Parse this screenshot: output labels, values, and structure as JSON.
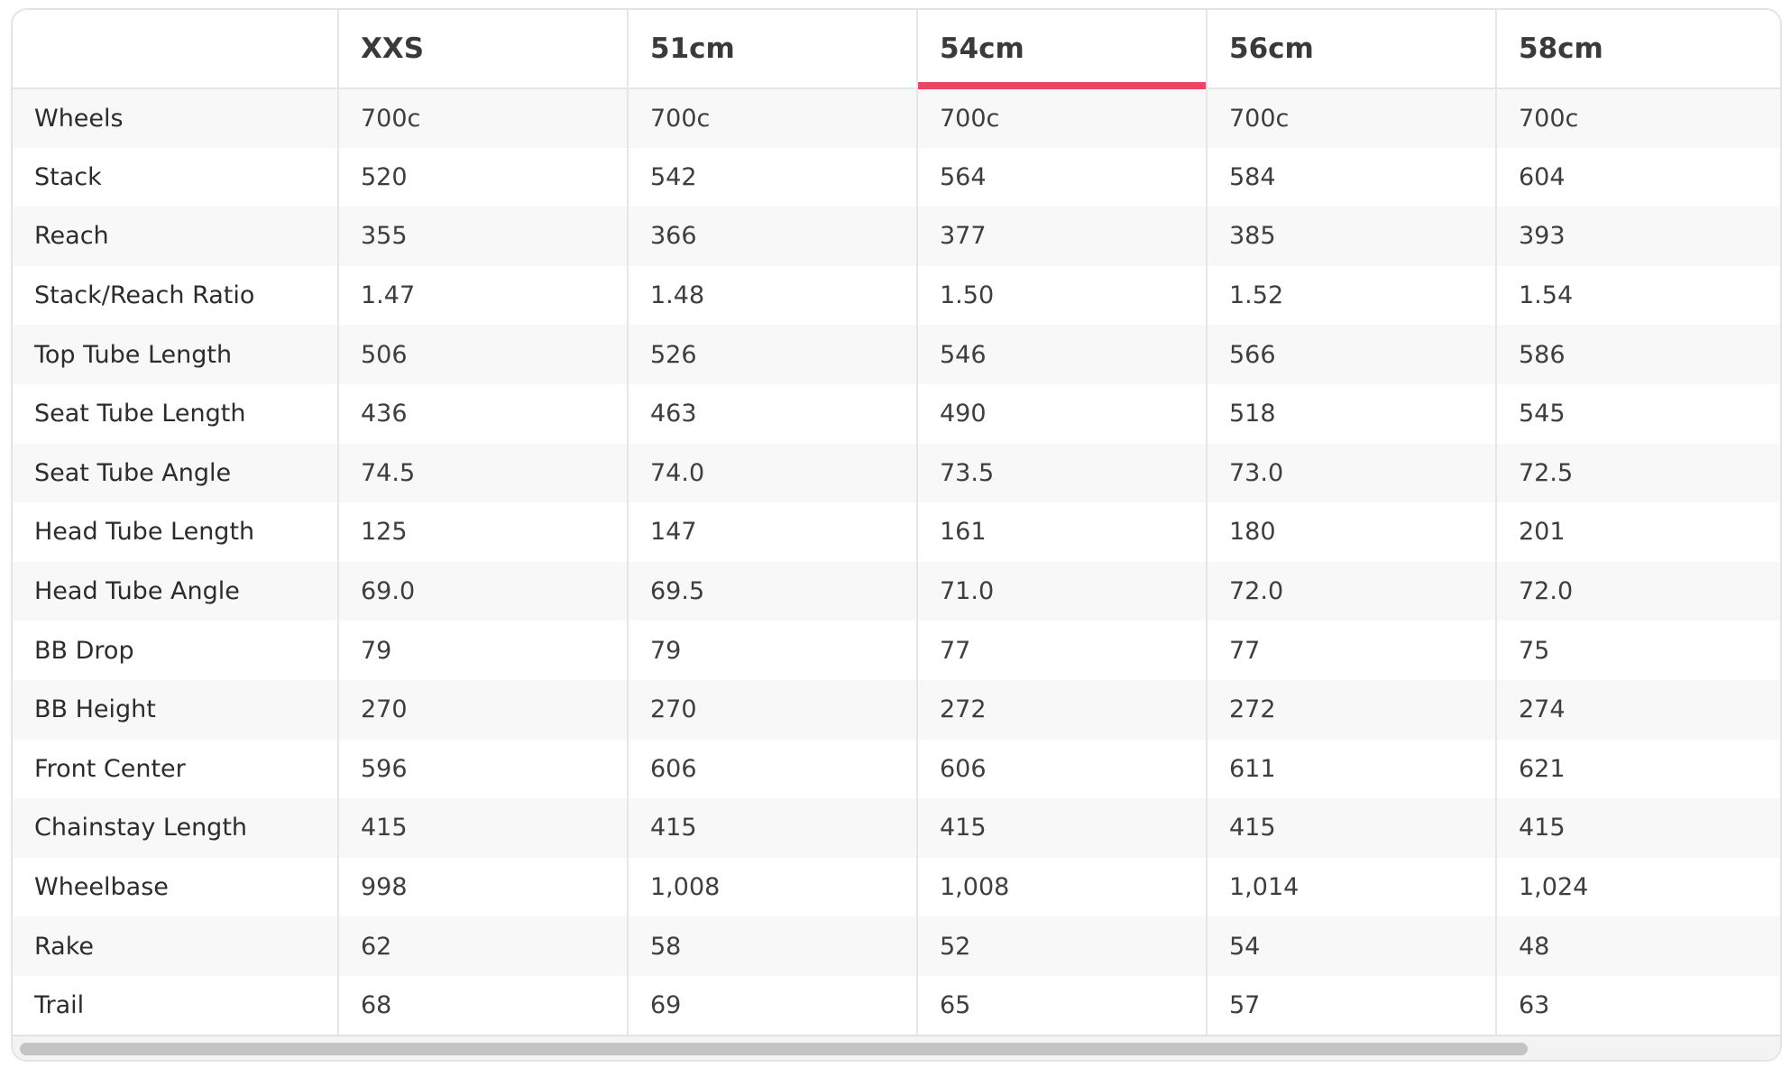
{
  "table": {
    "corner_label": "",
    "selected_column_index": 2,
    "accent_color": "#ea4564",
    "columns": [
      "XXS",
      "51cm",
      "54cm",
      "56cm",
      "58cm"
    ],
    "rows": [
      {
        "label": "Wheels",
        "values": [
          "700c",
          "700c",
          "700c",
          "700c",
          "700c"
        ]
      },
      {
        "label": "Stack",
        "values": [
          "520",
          "542",
          "564",
          "584",
          "604"
        ]
      },
      {
        "label": "Reach",
        "values": [
          "355",
          "366",
          "377",
          "385",
          "393"
        ]
      },
      {
        "label": "Stack/Reach Ratio",
        "values": [
          "1.47",
          "1.48",
          "1.50",
          "1.52",
          "1.54"
        ]
      },
      {
        "label": "Top Tube Length",
        "values": [
          "506",
          "526",
          "546",
          "566",
          "586"
        ]
      },
      {
        "label": "Seat Tube Length",
        "values": [
          "436",
          "463",
          "490",
          "518",
          "545"
        ]
      },
      {
        "label": "Seat Tube Angle",
        "values": [
          "74.5",
          "74.0",
          "73.5",
          "73.0",
          "72.5"
        ]
      },
      {
        "label": "Head Tube Length",
        "values": [
          "125",
          "147",
          "161",
          "180",
          "201"
        ]
      },
      {
        "label": "Head Tube Angle",
        "values": [
          "69.0",
          "69.5",
          "71.0",
          "72.0",
          "72.0"
        ]
      },
      {
        "label": "BB Drop",
        "values": [
          "79",
          "79",
          "77",
          "77",
          "75"
        ]
      },
      {
        "label": "BB Height",
        "values": [
          "270",
          "270",
          "272",
          "272",
          "274"
        ]
      },
      {
        "label": "Front Center",
        "values": [
          "596",
          "606",
          "606",
          "611",
          "621"
        ]
      },
      {
        "label": "Chainstay Length",
        "values": [
          "415",
          "415",
          "415",
          "415",
          "415"
        ]
      },
      {
        "label": "Wheelbase",
        "values": [
          "998",
          "1,008",
          "1,008",
          "1,014",
          "1,024"
        ]
      },
      {
        "label": "Rake",
        "values": [
          "62",
          "58",
          "52",
          "54",
          "48"
        ]
      },
      {
        "label": "Trail",
        "values": [
          "68",
          "69",
          "65",
          "57",
          "63"
        ]
      }
    ]
  }
}
